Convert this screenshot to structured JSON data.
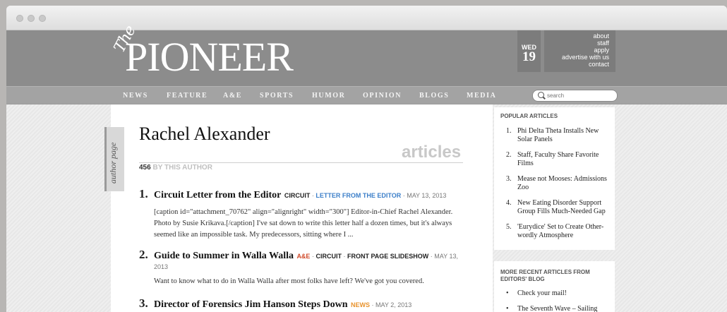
{
  "masthead": {
    "logo_the": "The",
    "logo_word": "PIONEER",
    "day_of_week": "WED",
    "day": "19",
    "links": [
      "about",
      "staff",
      "apply",
      "advertise with us",
      "contact"
    ]
  },
  "nav": {
    "items": [
      "NEWS",
      "FEATURE",
      "A&E",
      "SPORTS",
      "HUMOR",
      "OPINION",
      "BLOGS",
      "MEDIA"
    ],
    "search_placeholder": "search"
  },
  "page": {
    "tab_label": "author page",
    "author_name": "Rachel Alexander",
    "section_word": "articles",
    "count": "456",
    "count_label": "BY THIS AUTHOR"
  },
  "articles": [
    {
      "num": "1.",
      "title": "Circuit Letter from the Editor",
      "cats": [
        "CIRCUIT",
        "LETTER FROM THE EDITOR"
      ],
      "date": "MAY 13, 2013",
      "excerpt": "[caption id=\"attachment_70762\" align=\"alignright\" width=\"300\"] Editor-in-Chief Rachel Alexander. Photo by Susie Krikava.[/caption] I've sat down to write this letter half a dozen times, but it's always seemed like an impossible task. My predecessors, sitting where I ..."
    },
    {
      "num": "2.",
      "title": "Guide to Summer in Walla Walla",
      "cats": [
        "A&E",
        "CIRCUIT",
        "FRONT PAGE SLIDESHOW"
      ],
      "date": "MAY 13,",
      "date2": "2013",
      "excerpt": "Want to know what to do in Walla Walla after most folks have left? We've got you covered."
    },
    {
      "num": "3.",
      "title": "Director of Forensics Jim Hanson Steps Down",
      "cats": [
        "NEWS"
      ],
      "date": "MAY 2, 2013"
    }
  ],
  "sidebar": {
    "popular_heading": "POPULAR ARTICLES",
    "popular": [
      {
        "n": "1.",
        "title": "Phi Delta Theta Installs New Solar Panels"
      },
      {
        "n": "2.",
        "title": "Staff, Faculty Share Favorite Films"
      },
      {
        "n": "3.",
        "title": "Mease not Mooses: Admissions Zoo"
      },
      {
        "n": "4.",
        "title": "New Eating Disorder Support Group Fills Much-Needed Gap"
      },
      {
        "n": "5.",
        "title": "'Eurydice' Set to Create Other-wordly Atmosphere"
      }
    ],
    "recent_heading_1": "MORE RECENT ARTICLES FROM",
    "recent_heading_2": "EDITORS' BLOG",
    "recent": [
      "Check your mail!",
      "The Seventh Wave – Sailing Away"
    ]
  },
  "colors": {
    "masthead": "#8c8c8c",
    "nav": "#a3a3a3",
    "link_blue": "#3c7fc9",
    "ae_red": "#d04a2a",
    "news_orange": "#e8932e"
  }
}
